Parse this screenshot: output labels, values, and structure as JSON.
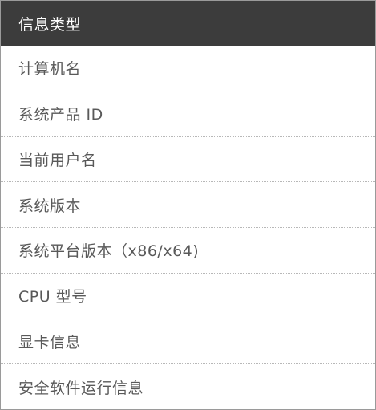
{
  "table": {
    "header": "信息类型",
    "rows": [
      "计算机名",
      "系统产品 ID",
      "当前用户名",
      "系统版本",
      "系统平台版本（x86/x64)",
      "CPU  型号",
      "显卡信息",
      "安全软件运行信息"
    ]
  },
  "colors": {
    "header_background": "#3c3c3c",
    "header_text": "#ffffff",
    "row_text": "#595959",
    "row_divider": "#b7b7b7"
  }
}
